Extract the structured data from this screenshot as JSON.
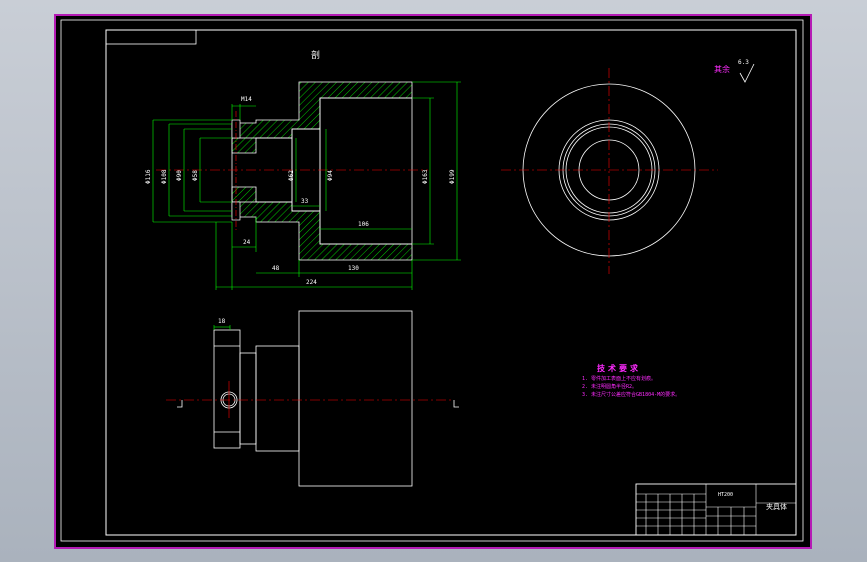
{
  "colors": {
    "background": "#000000",
    "frame": "#ffffff",
    "viewport_border": "#b51bb5",
    "dimension": "#00ff00",
    "centerline": "#ff0000",
    "annotation": "#ff2bff",
    "hatch": "#00ff00"
  },
  "section_label": "剖",
  "dimensions": {
    "m14": "M14",
    "d116": "Φ116",
    "d108": "Φ108",
    "d90": "Φ90",
    "d58": "Φ58",
    "d62": "Φ62",
    "d94": "Φ94",
    "d163": "Φ163",
    "d199": "Φ199",
    "l33": "33",
    "l106": "106",
    "l24": "24",
    "l48": "48",
    "l130": "130",
    "l224": "224",
    "l18": "18"
  },
  "roughness": {
    "label": "其余",
    "value": "6.3"
  },
  "tech_requirements": {
    "title": "技术要求",
    "items": [
      "1. 零件加工表面上不应有划痕。",
      "2. 未注明圆角半径R2。",
      "3. 未注尺寸公差应符合GB1804-M的要求。"
    ]
  },
  "title_block": {
    "material": "HT200",
    "part_name": "夹具体"
  }
}
